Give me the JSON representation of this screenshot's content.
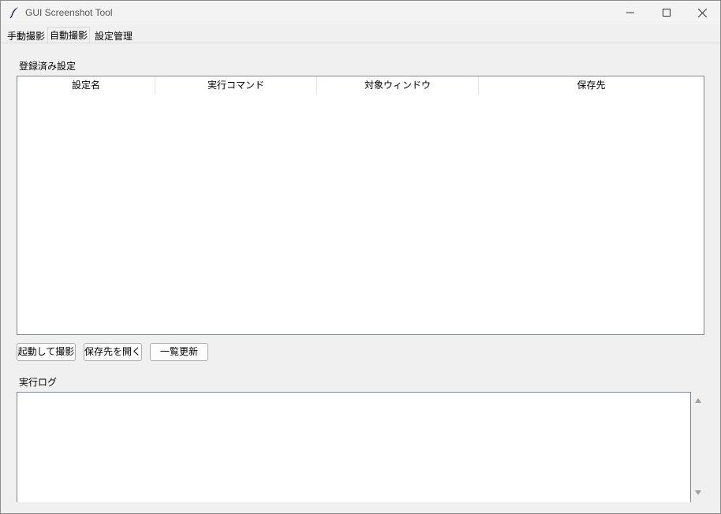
{
  "window": {
    "title": "GUI Screenshot Tool"
  },
  "tabs": [
    {
      "label": "手動撮影",
      "active": false
    },
    {
      "label": "自動撮影",
      "active": true
    },
    {
      "label": "設定管理",
      "active": false
    }
  ],
  "settings": {
    "section_label": "登録済み設定",
    "columns": [
      "設定名",
      "実行コマンド",
      "対象ウィンドウ",
      "保存先"
    ],
    "rows": []
  },
  "buttons": {
    "launch_capture": "起動して撮影",
    "open_save_location": "保存先を開く",
    "refresh_list": "一覧更新"
  },
  "log": {
    "section_label": "実行ログ",
    "content": ""
  },
  "icons": {
    "app": "feather-icon",
    "minimize": "minimize-icon",
    "maximize": "maximize-icon",
    "close": "close-icon",
    "scroll_up": "triangle-up-icon",
    "scroll_down": "triangle-down-icon"
  }
}
